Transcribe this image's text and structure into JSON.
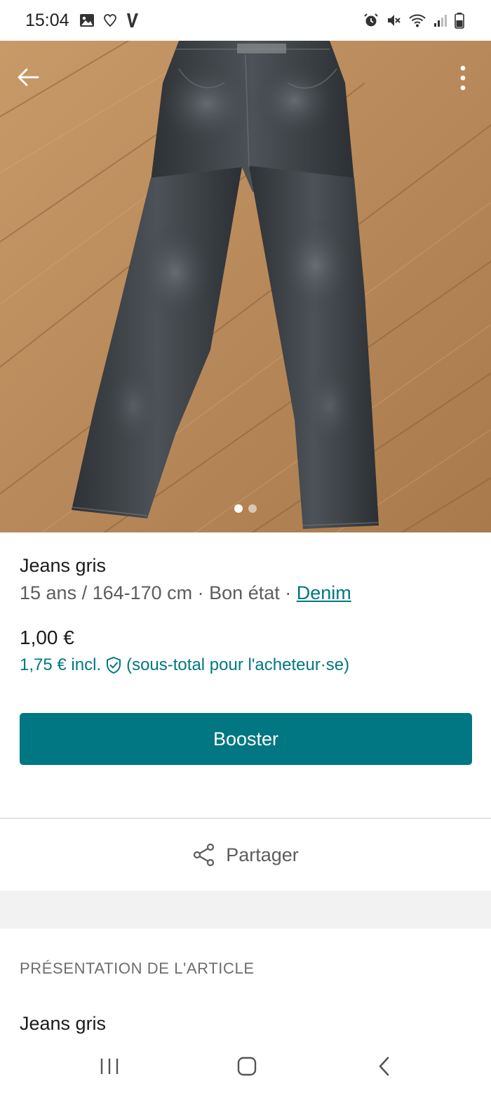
{
  "status_bar": {
    "time": "15:04",
    "left_icons": [
      "gallery-icon",
      "heart-outline-icon",
      "vinted-v-icon"
    ],
    "right_icons": [
      "alarm-icon",
      "mute-icon",
      "wifi-icon",
      "signal-icon",
      "battery-icon"
    ]
  },
  "gallery": {
    "image_count": 2,
    "active_index": 0
  },
  "item": {
    "title": "Jeans gris",
    "size": "15 ans / 164-170 cm",
    "separator": " · ",
    "condition": "Bon état",
    "brand": "Denim",
    "price": "1,00 €",
    "price_incl_prefix": "1,75 € incl.",
    "price_incl_suffix": "(sous-total pour l'acheteur·se)"
  },
  "actions": {
    "booster_label": "Booster",
    "share_label": "Partager"
  },
  "presentation": {
    "heading": "PRÉSENTATION DE L'ARTICLE",
    "description": "Jeans gris"
  },
  "colors": {
    "accent": "#007782",
    "text": "#1b1b1b",
    "muted": "#5d5d5d"
  }
}
